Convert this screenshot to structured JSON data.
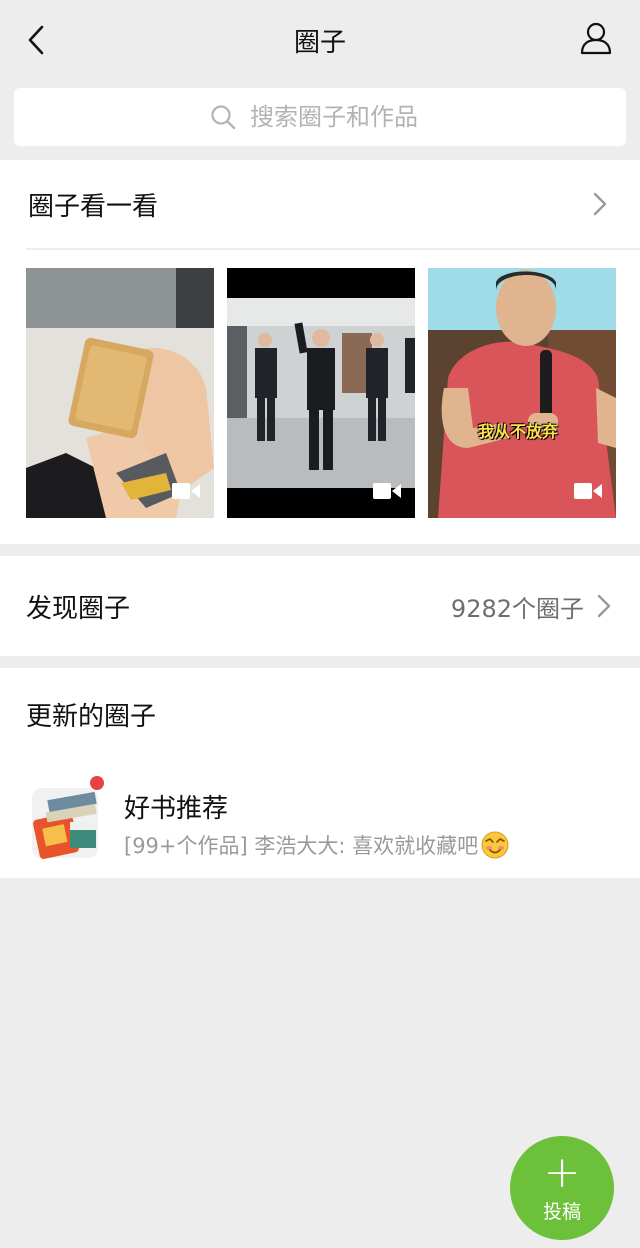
{
  "header": {
    "title": "圈子"
  },
  "search": {
    "placeholder": "搜索圈子和作品"
  },
  "browse": {
    "label": "圈子看一看",
    "thumbnails": [
      {
        "kind": "video"
      },
      {
        "kind": "video"
      },
      {
        "kind": "video",
        "caption": "我从不放弃"
      }
    ]
  },
  "discover": {
    "label": "发现圈子",
    "count": "9282个圈子"
  },
  "updated": {
    "label": "更新的圈子",
    "items": [
      {
        "name": "好书推荐",
        "description": "[99+个作品] 李浩大大: 喜欢就收藏吧"
      }
    ]
  },
  "fab": {
    "plus": "+",
    "label": "投稿"
  },
  "colors": {
    "accent": "#6cc03a",
    "badge": "#e64340",
    "background": "#ededed"
  }
}
